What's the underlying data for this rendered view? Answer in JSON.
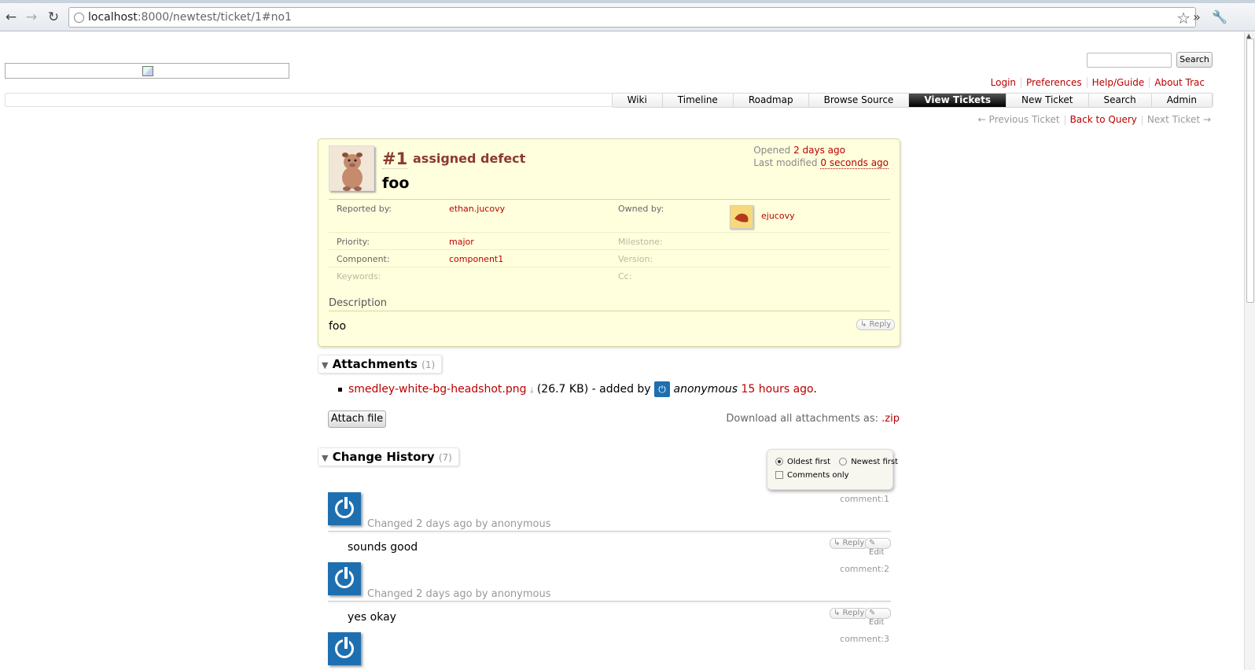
{
  "browser": {
    "url_host": "localhost",
    "url_rest": ":8000/newtest/ticket/1#no1"
  },
  "header": {
    "search_button": "Search",
    "metanav": [
      "Login",
      "Preferences",
      "Help/Guide",
      "About Trac"
    ],
    "mainnav": [
      "Wiki",
      "Timeline",
      "Roadmap",
      "Browse Source",
      "View Tickets",
      "New Ticket",
      "Search",
      "Admin"
    ],
    "active_nav": "View Tickets"
  },
  "ctxtnav": {
    "prev": "← Previous Ticket",
    "back": "Back to Query",
    "next": "Next Ticket →"
  },
  "ticket": {
    "id": "#1",
    "status_type": "assigned defect",
    "summary": "foo",
    "opened_label": "Opened",
    "opened": "2 days ago",
    "modified_label": "Last modified",
    "modified": "0 seconds ago",
    "props": {
      "reported_by_label": "Reported by:",
      "reported_by": "ethan.jucovy",
      "owned_by_label": "Owned by:",
      "owned_by": "ejucovy",
      "priority_label": "Priority:",
      "priority": "major",
      "milestone_label": "Milestone:",
      "component_label": "Component:",
      "component": "component1",
      "version_label": "Version:",
      "keywords_label": "Keywords:",
      "cc_label": "Cc:"
    },
    "description_label": "Description",
    "description": "foo",
    "reply": "↳ Reply"
  },
  "attachments": {
    "title": "Attachments",
    "count": "(1)",
    "file": "smedley-white-bg-headshot.png",
    "size": "(26.7 KB) - added by",
    "author": "anonymous",
    "when": "15 hours ago",
    "attach_button": "Attach file",
    "download_label": "Download all attachments as:",
    "download_link": ".zip"
  },
  "history": {
    "title": "Change History",
    "count": "(7)",
    "oldest": "Oldest first",
    "newest": "Newest first",
    "comments_only": "Comments only",
    "reply": "↳ Reply",
    "edit": "✎ Edit",
    "changes": [
      {
        "num": "comment:1",
        "by": "Changed 2 days ago by anonymous",
        "text": "sounds good"
      },
      {
        "num": "comment:2",
        "by": "Changed 2 days ago by anonymous",
        "text": "yes okay"
      },
      {
        "num": "comment:3",
        "by": "",
        "text": ""
      }
    ]
  }
}
